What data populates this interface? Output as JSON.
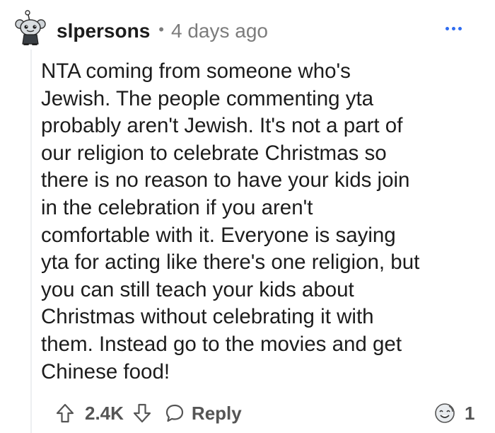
{
  "comment": {
    "author": "slpersons",
    "separator": "•",
    "timestamp": "4 days ago",
    "avatar_icon": "snoo-avatar-icon",
    "more_icon": "more-options-icon",
    "body_lines": [
      "NTA coming from someone who's",
      "Jewish. The people commenting yta",
      "probably aren't Jewish. It's not a part of",
      "our religion to celebrate Christmas so",
      "there is no reason to have your kids join",
      "in the celebration if you aren't",
      "comfortable with it. Everyone is saying",
      "yta for acting like there's one religion, but",
      "you can still teach your kids about",
      "Christmas without celebrating it with",
      "them. Instead go to the movies and get",
      "Chinese food!"
    ],
    "actions": {
      "upvote_icon": "arrow-up-icon",
      "vote_count": "2.4K",
      "downvote_icon": "arrow-down-icon",
      "reply_icon": "chat-bubble-icon",
      "reply_label": "Reply"
    },
    "award": {
      "icon": "award-icon",
      "count": "1"
    }
  },
  "colors": {
    "text": "#1c1c1c",
    "meta": "#7c7c7c",
    "action": "#555555",
    "accent": "#2f6cf0",
    "thread_line": "#edeff1"
  }
}
